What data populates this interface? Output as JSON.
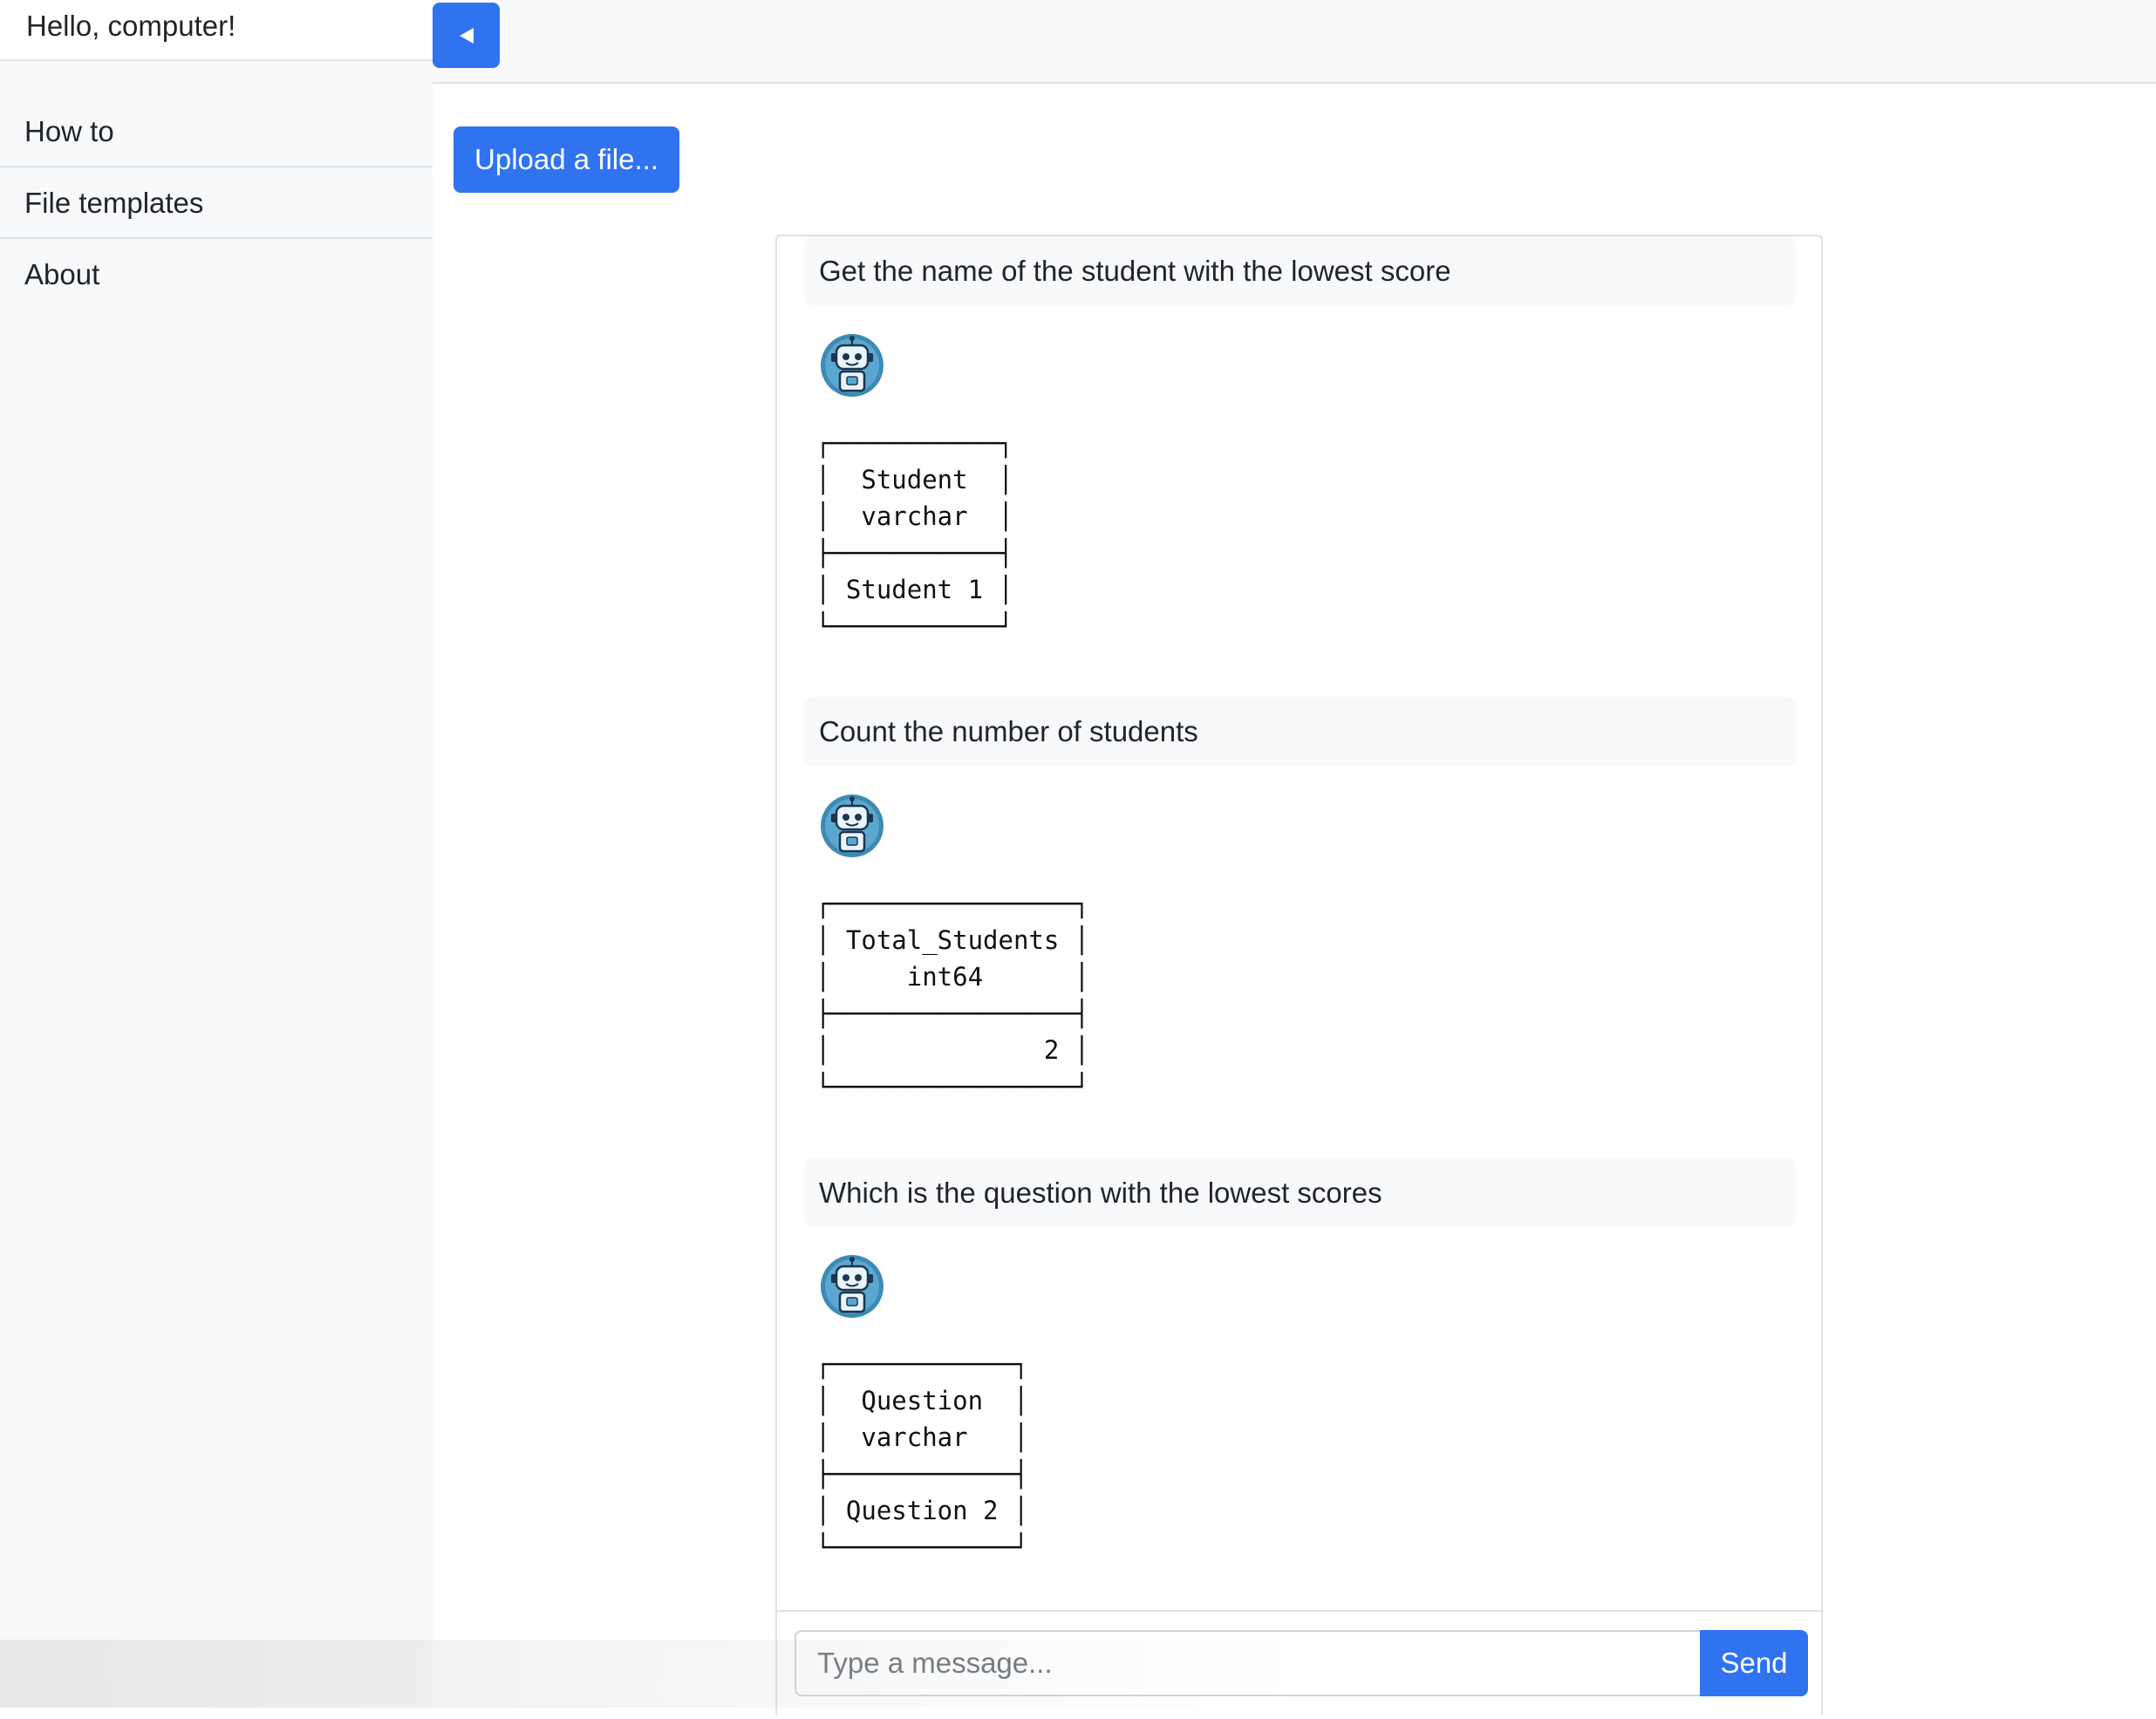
{
  "sidebar": {
    "greeting": "Hello, computer!",
    "items": [
      {
        "label": "How to"
      },
      {
        "label": "File templates"
      },
      {
        "label": "About"
      }
    ]
  },
  "topbar": {
    "toggle_icon": "caret-left-icon"
  },
  "upload": {
    "label": "Upload a file..."
  },
  "chat": {
    "messages": [
      {
        "user": "Get the name of the student with the lowest score",
        "bot_avatar": "robot-icon",
        "result": "┌───────────┐\n│  Student  │\n│  varchar  │\n├───────────┤\n│ Student 1 │\n└───────────┘"
      },
      {
        "user": "Count the number of students",
        "bot_avatar": "robot-icon",
        "result": "┌────────────────┐\n│ Total_Students │\n│     int64      │\n├────────────────┤\n│              2 │\n└────────────────┘"
      },
      {
        "user": "Which is the question with the lowest scores",
        "bot_avatar": "robot-icon",
        "result": "┌────────────┐\n│  Question  │\n│  varchar   │\n├────────────┤\n│ Question 2 │\n└────────────┘"
      }
    ]
  },
  "composer": {
    "placeholder": "Type a message...",
    "send_label": "Send"
  },
  "colors": {
    "accent": "#2f73f0",
    "sidebar_bg": "#f8f9fa",
    "border": "#dee2e6"
  }
}
